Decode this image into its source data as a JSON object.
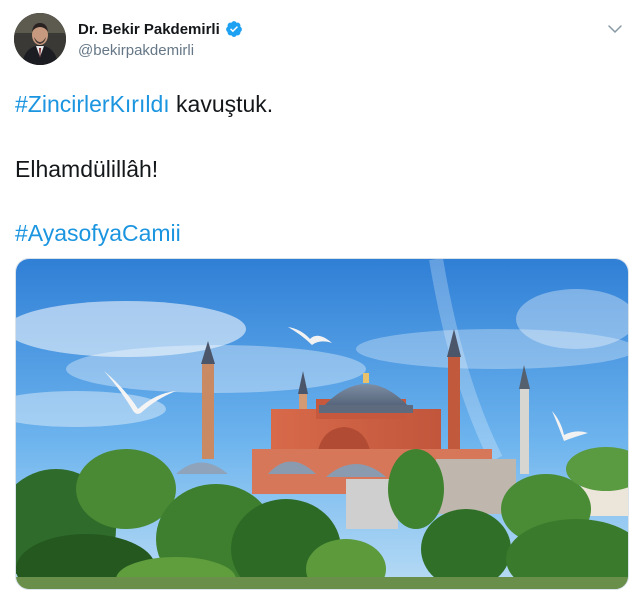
{
  "author": {
    "display_name": "Dr. Bekir Pakdemirli",
    "handle": "@bekirpakdemirli",
    "verified": true,
    "avatar_icon": "profile-photo"
  },
  "tweet": {
    "line1_hashtag": "#ZincirlerKırıldı",
    "line1_text": " kavuştuk.",
    "line2_text": "Elhamdülillâh!",
    "line3_hashtag": "#AyasofyaCamii"
  },
  "media": {
    "icon": "photo-hagia-sophia"
  },
  "colors": {
    "hashtag": "#1b95e0",
    "text": "#14171a",
    "handle": "#657786",
    "verified": "#1da1f2"
  }
}
